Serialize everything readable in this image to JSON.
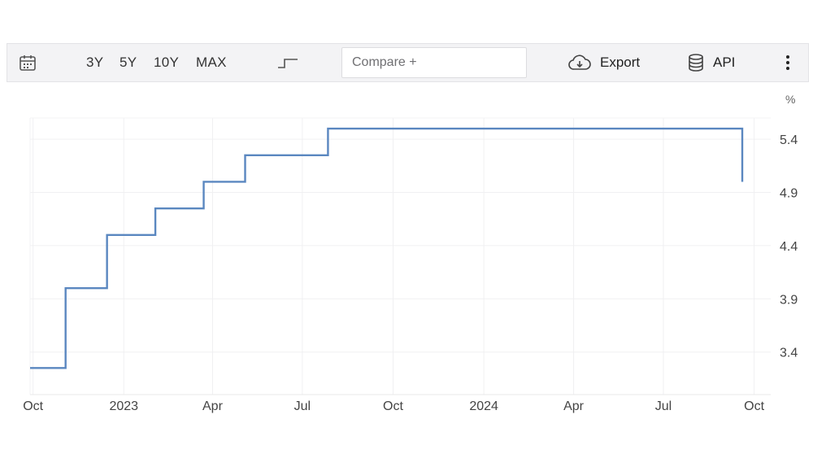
{
  "toolbar": {
    "calendar_icon": "calendar-icon",
    "ranges": [
      "3Y",
      "5Y",
      "10Y",
      "MAX"
    ],
    "chart_type_icon": "step-line-icon",
    "compare_placeholder": "Compare +",
    "export_label": "Export",
    "export_icon": "cloud-download-icon",
    "api_label": "API",
    "api_icon": "database-icon",
    "more_icon": "vertical-ellipsis-icon"
  },
  "colors": {
    "line": "#5a87c0",
    "grid": "#f0f0f2",
    "toolbar_bg": "#f3f3f5"
  },
  "chart_data": {
    "type": "line",
    "step": true,
    "unit": "%",
    "x_ticks": [
      "Oct",
      "2023",
      "Apr",
      "Jul",
      "Oct",
      "2024",
      "Apr",
      "Jul",
      "Oct"
    ],
    "y_ticks": [
      "3.4",
      "3.9",
      "4.4",
      "4.9",
      "5.4"
    ],
    "ylim": [
      3.0,
      5.6
    ],
    "xlim": [
      "2022-09-28",
      "2024-10-03"
    ],
    "axis_side": "right",
    "grid": true,
    "series": [
      {
        "x": [
          "2022-09-28",
          "2022-11-03",
          "2022-12-15",
          "2023-02-02",
          "2023-03-23",
          "2023-05-04",
          "2023-07-27",
          "2024-09-19"
        ],
        "values": [
          3.25,
          4.0,
          4.5,
          4.75,
          5.0,
          5.25,
          5.5,
          5.0
        ]
      }
    ]
  }
}
